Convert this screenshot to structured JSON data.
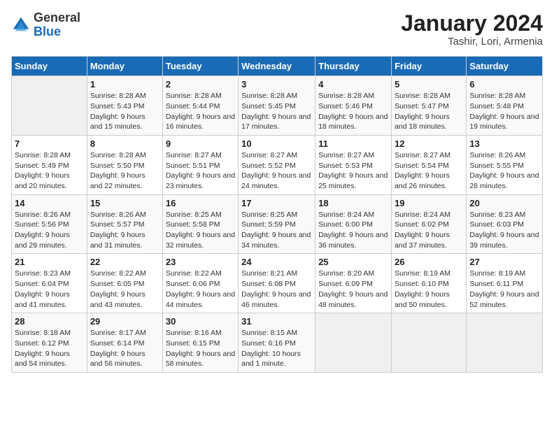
{
  "logo": {
    "general": "General",
    "blue": "Blue"
  },
  "header": {
    "month_year": "January 2024",
    "location": "Tashir, Lori, Armenia"
  },
  "weekdays": [
    "Sunday",
    "Monday",
    "Tuesday",
    "Wednesday",
    "Thursday",
    "Friday",
    "Saturday"
  ],
  "weeks": [
    [
      {
        "day": "",
        "sunrise": "",
        "sunset": "",
        "daylight": "",
        "empty": true
      },
      {
        "day": "1",
        "sunrise": "Sunrise: 8:28 AM",
        "sunset": "Sunset: 5:43 PM",
        "daylight": "Daylight: 9 hours and 15 minutes."
      },
      {
        "day": "2",
        "sunrise": "Sunrise: 8:28 AM",
        "sunset": "Sunset: 5:44 PM",
        "daylight": "Daylight: 9 hours and 16 minutes."
      },
      {
        "day": "3",
        "sunrise": "Sunrise: 8:28 AM",
        "sunset": "Sunset: 5:45 PM",
        "daylight": "Daylight: 9 hours and 17 minutes."
      },
      {
        "day": "4",
        "sunrise": "Sunrise: 8:28 AM",
        "sunset": "Sunset: 5:46 PM",
        "daylight": "Daylight: 9 hours and 18 minutes."
      },
      {
        "day": "5",
        "sunrise": "Sunrise: 8:28 AM",
        "sunset": "Sunset: 5:47 PM",
        "daylight": "Daylight: 9 hours and 18 minutes."
      },
      {
        "day": "6",
        "sunrise": "Sunrise: 8:28 AM",
        "sunset": "Sunset: 5:48 PM",
        "daylight": "Daylight: 9 hours and 19 minutes."
      }
    ],
    [
      {
        "day": "7",
        "sunrise": "Sunrise: 8:28 AM",
        "sunset": "Sunset: 5:49 PM",
        "daylight": "Daylight: 9 hours and 20 minutes."
      },
      {
        "day": "8",
        "sunrise": "Sunrise: 8:28 AM",
        "sunset": "Sunset: 5:50 PM",
        "daylight": "Daylight: 9 hours and 22 minutes."
      },
      {
        "day": "9",
        "sunrise": "Sunrise: 8:27 AM",
        "sunset": "Sunset: 5:51 PM",
        "daylight": "Daylight: 9 hours and 23 minutes."
      },
      {
        "day": "10",
        "sunrise": "Sunrise: 8:27 AM",
        "sunset": "Sunset: 5:52 PM",
        "daylight": "Daylight: 9 hours and 24 minutes."
      },
      {
        "day": "11",
        "sunrise": "Sunrise: 8:27 AM",
        "sunset": "Sunset: 5:53 PM",
        "daylight": "Daylight: 9 hours and 25 minutes."
      },
      {
        "day": "12",
        "sunrise": "Sunrise: 8:27 AM",
        "sunset": "Sunset: 5:54 PM",
        "daylight": "Daylight: 9 hours and 26 minutes."
      },
      {
        "day": "13",
        "sunrise": "Sunrise: 8:26 AM",
        "sunset": "Sunset: 5:55 PM",
        "daylight": "Daylight: 9 hours and 28 minutes."
      }
    ],
    [
      {
        "day": "14",
        "sunrise": "Sunrise: 8:26 AM",
        "sunset": "Sunset: 5:56 PM",
        "daylight": "Daylight: 9 hours and 29 minutes."
      },
      {
        "day": "15",
        "sunrise": "Sunrise: 8:26 AM",
        "sunset": "Sunset: 5:57 PM",
        "daylight": "Daylight: 9 hours and 31 minutes."
      },
      {
        "day": "16",
        "sunrise": "Sunrise: 8:25 AM",
        "sunset": "Sunset: 5:58 PM",
        "daylight": "Daylight: 9 hours and 32 minutes."
      },
      {
        "day": "17",
        "sunrise": "Sunrise: 8:25 AM",
        "sunset": "Sunset: 5:59 PM",
        "daylight": "Daylight: 9 hours and 34 minutes."
      },
      {
        "day": "18",
        "sunrise": "Sunrise: 8:24 AM",
        "sunset": "Sunset: 6:00 PM",
        "daylight": "Daylight: 9 hours and 36 minutes."
      },
      {
        "day": "19",
        "sunrise": "Sunrise: 8:24 AM",
        "sunset": "Sunset: 6:02 PM",
        "daylight": "Daylight: 9 hours and 37 minutes."
      },
      {
        "day": "20",
        "sunrise": "Sunrise: 8:23 AM",
        "sunset": "Sunset: 6:03 PM",
        "daylight": "Daylight: 9 hours and 39 minutes."
      }
    ],
    [
      {
        "day": "21",
        "sunrise": "Sunrise: 8:23 AM",
        "sunset": "Sunset: 6:04 PM",
        "daylight": "Daylight: 9 hours and 41 minutes."
      },
      {
        "day": "22",
        "sunrise": "Sunrise: 8:22 AM",
        "sunset": "Sunset: 6:05 PM",
        "daylight": "Daylight: 9 hours and 43 minutes."
      },
      {
        "day": "23",
        "sunrise": "Sunrise: 8:22 AM",
        "sunset": "Sunset: 6:06 PM",
        "daylight": "Daylight: 9 hours and 44 minutes."
      },
      {
        "day": "24",
        "sunrise": "Sunrise: 8:21 AM",
        "sunset": "Sunset: 6:08 PM",
        "daylight": "Daylight: 9 hours and 46 minutes."
      },
      {
        "day": "25",
        "sunrise": "Sunrise: 8:20 AM",
        "sunset": "Sunset: 6:09 PM",
        "daylight": "Daylight: 9 hours and 48 minutes."
      },
      {
        "day": "26",
        "sunrise": "Sunrise: 8:19 AM",
        "sunset": "Sunset: 6:10 PM",
        "daylight": "Daylight: 9 hours and 50 minutes."
      },
      {
        "day": "27",
        "sunrise": "Sunrise: 8:19 AM",
        "sunset": "Sunset: 6:11 PM",
        "daylight": "Daylight: 9 hours and 52 minutes."
      }
    ],
    [
      {
        "day": "28",
        "sunrise": "Sunrise: 8:18 AM",
        "sunset": "Sunset: 6:12 PM",
        "daylight": "Daylight: 9 hours and 54 minutes."
      },
      {
        "day": "29",
        "sunrise": "Sunrise: 8:17 AM",
        "sunset": "Sunset: 6:14 PM",
        "daylight": "Daylight: 9 hours and 56 minutes."
      },
      {
        "day": "30",
        "sunrise": "Sunrise: 8:16 AM",
        "sunset": "Sunset: 6:15 PM",
        "daylight": "Daylight: 9 hours and 58 minutes."
      },
      {
        "day": "31",
        "sunrise": "Sunrise: 8:15 AM",
        "sunset": "Sunset: 6:16 PM",
        "daylight": "Daylight: 10 hours and 1 minute."
      },
      {
        "day": "",
        "sunrise": "",
        "sunset": "",
        "daylight": "",
        "empty": true
      },
      {
        "day": "",
        "sunrise": "",
        "sunset": "",
        "daylight": "",
        "empty": true
      },
      {
        "day": "",
        "sunrise": "",
        "sunset": "",
        "daylight": "",
        "empty": true
      }
    ]
  ]
}
